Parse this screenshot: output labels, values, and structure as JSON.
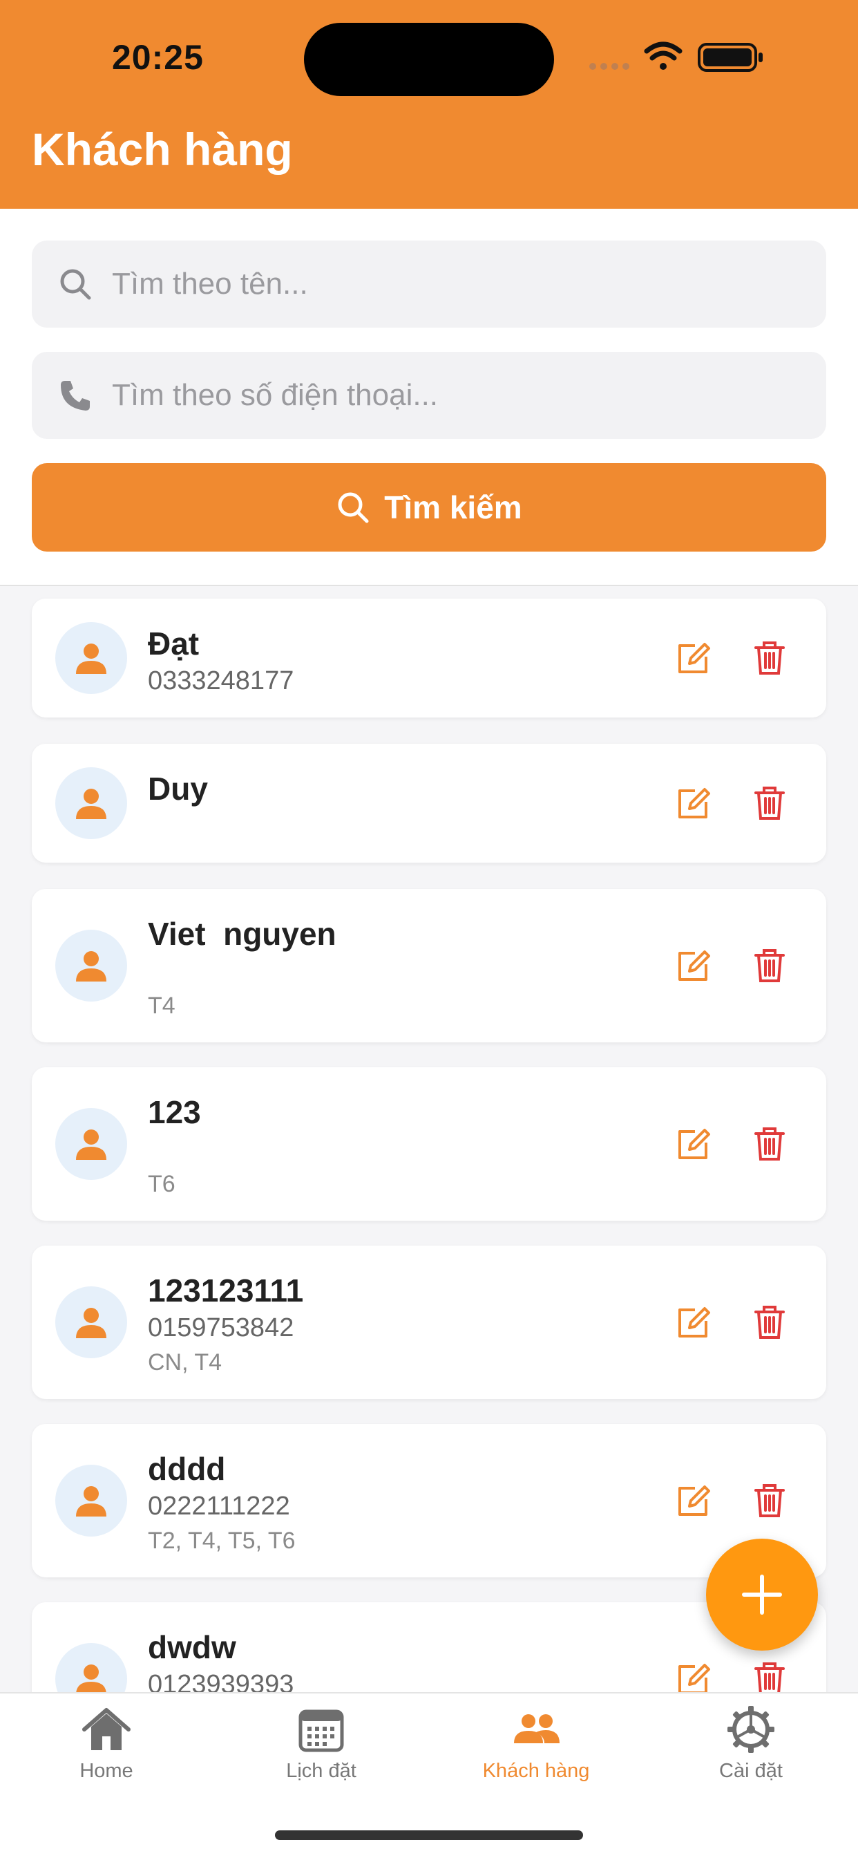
{
  "status_bar": {
    "time": "20:25"
  },
  "header": {
    "title": "Khách hàng"
  },
  "search": {
    "name_placeholder": "Tìm theo tên...",
    "phone_placeholder": "Tìm theo số điện thoại...",
    "button_label": "Tìm kiếm"
  },
  "customers": [
    {
      "name": "Đạt",
      "phone": "0333248177",
      "days": ""
    },
    {
      "name": "Duy",
      "phone": "",
      "days": ""
    },
    {
      "name": "Viet  nguyen",
      "phone": "",
      "days": "T4"
    },
    {
      "name": "123",
      "phone": "",
      "days": "T6"
    },
    {
      "name": "123123111",
      "phone": "0159753842",
      "days": "CN, T4"
    },
    {
      "name": "dddd",
      "phone": "0222111222",
      "days": "T2, T4, T5, T6"
    },
    {
      "name": "dwdw",
      "phone": "0123939393",
      "days": ""
    }
  ],
  "tabs": [
    {
      "label": "Home",
      "icon": "home-icon",
      "active": false
    },
    {
      "label": "Lịch đặt",
      "icon": "calendar-icon",
      "active": false
    },
    {
      "label": "Khách hàng",
      "icon": "people-icon",
      "active": true
    },
    {
      "label": "Cài đặt",
      "icon": "gear-icon",
      "active": false
    }
  ],
  "colors": {
    "accent": "#F08A30",
    "fab": "#FF9810",
    "delete": "#E03A3A",
    "avatar_bg": "#E6F0FA",
    "background": "#F5F5F7"
  }
}
